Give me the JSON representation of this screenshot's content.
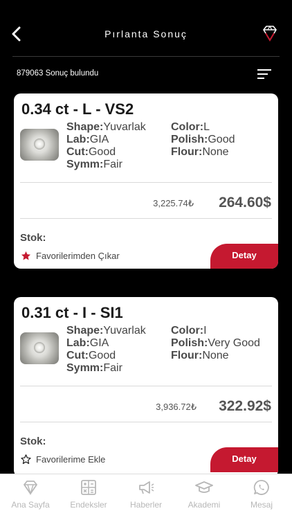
{
  "header": {
    "title": "Pırlanta Sonuç"
  },
  "results": {
    "count_text": "879063 Sonuç bulundu"
  },
  "cards": [
    {
      "title": "0.34 ct - L - VS2",
      "specs": {
        "shape_label": "Shape:",
        "shape": "Yuvarlak",
        "color_label": "Color:",
        "color": "L",
        "lab_label": "Lab:",
        "lab": "GIA",
        "polish_label": "Polish:",
        "polish": "Good",
        "cut_label": "Cut:",
        "cut": "Good",
        "flour_label": "Flour:",
        "flour": "None",
        "symm_label": "Symm:",
        "symm": "Fair"
      },
      "price_try": "3,225.74₺",
      "price_usd": "264.60$",
      "stok_label": "Stok:",
      "favorite_text": "Favorilerimden Çıkar",
      "favorited": true,
      "detail_label": "Detay"
    },
    {
      "title": "0.31 ct - I - SI1",
      "specs": {
        "shape_label": "Shape:",
        "shape": "Yuvarlak",
        "color_label": "Color:",
        "color": "I",
        "lab_label": "Lab:",
        "lab": "GIA",
        "polish_label": "Polish:",
        "polish": "Very Good",
        "cut_label": "Cut:",
        "cut": "Good",
        "flour_label": "Flour:",
        "flour": "None",
        "symm_label": "Symm:",
        "symm": "Fair"
      },
      "price_try": "3,936.72₺",
      "price_usd": "322.92$",
      "stok_label": "Stok:",
      "favorite_text": "Favorilerime Ekle",
      "favorited": false,
      "detail_label": "Detay"
    }
  ],
  "tabbar": [
    {
      "label": "Ana Sayfa",
      "icon": "diamond-icon"
    },
    {
      "label": "Endeksler",
      "icon": "calculator-icon"
    },
    {
      "label": "Haberler",
      "icon": "megaphone-icon"
    },
    {
      "label": "Akademi",
      "icon": "graduation-cap-icon"
    },
    {
      "label": "Mesaj",
      "icon": "whatsapp-icon"
    }
  ],
  "colors": {
    "accent": "#c51930",
    "background": "#000000",
    "tab_inactive": "#b7b7b7"
  }
}
